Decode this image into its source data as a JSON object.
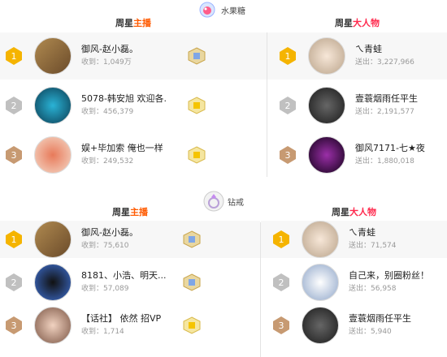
{
  "sections": [
    {
      "gift": "水果糖",
      "left_title": {
        "prefix": "周星",
        "highlight": "主播"
      },
      "right_title": {
        "prefix": "周星",
        "highlight": "大人物"
      },
      "hosts": [
        {
          "rank": "1",
          "name": "御风-赵小磊。",
          "stat": "收到：1,049万"
        },
        {
          "rank": "2",
          "name": "5078-韩安旭 欢迎各.",
          "stat": "收到：456,379"
        },
        {
          "rank": "3",
          "name": "娱+毕加索 俺也一样",
          "stat": "收到：249,532"
        }
      ],
      "vips": [
        {
          "rank": "1",
          "name": "ㄟ青蛙",
          "stat": "送出：3,227,966"
        },
        {
          "rank": "2",
          "name": "壹蓑烟雨任平生",
          "stat": "送出：2,191,577"
        },
        {
          "rank": "3",
          "name": "御风7171-七★夜",
          "stat": "送出：1,880,018"
        }
      ]
    },
    {
      "gift": "钻戒",
      "left_title": {
        "prefix": "周星",
        "highlight": "主播"
      },
      "right_title": {
        "prefix": "周星",
        "highlight": "大人物"
      },
      "hosts": [
        {
          "rank": "1",
          "name": "御风-赵小磊。",
          "stat": "收到：75,610"
        },
        {
          "rank": "2",
          "name": "8181、小浩、明天...",
          "stat": "收到：57,089"
        },
        {
          "rank": "3",
          "name": "【话社】 依然 招VP",
          "stat": "收到：1,714"
        }
      ],
      "vips": [
        {
          "rank": "1",
          "name": "ㄟ青蛙",
          "stat": "送出：71,574"
        },
        {
          "rank": "2",
          "name": "自己来，别圈粉丝！",
          "stat": "送出：56,958"
        },
        {
          "rank": "3",
          "name": "壹蓑烟雨任平生",
          "stat": "送出：5,940"
        }
      ]
    }
  ],
  "colors": {
    "gold": "#f5b400",
    "silver": "#c0c0c0",
    "bronze": "#c79a72",
    "highlight_host": "#ff5a00",
    "highlight_vip": "#ff2a4e"
  },
  "icons": {
    "gift1": "candy-icon",
    "gift2": "ring-icon",
    "medal": "medal-icon",
    "cube": "level-cube-icon"
  }
}
